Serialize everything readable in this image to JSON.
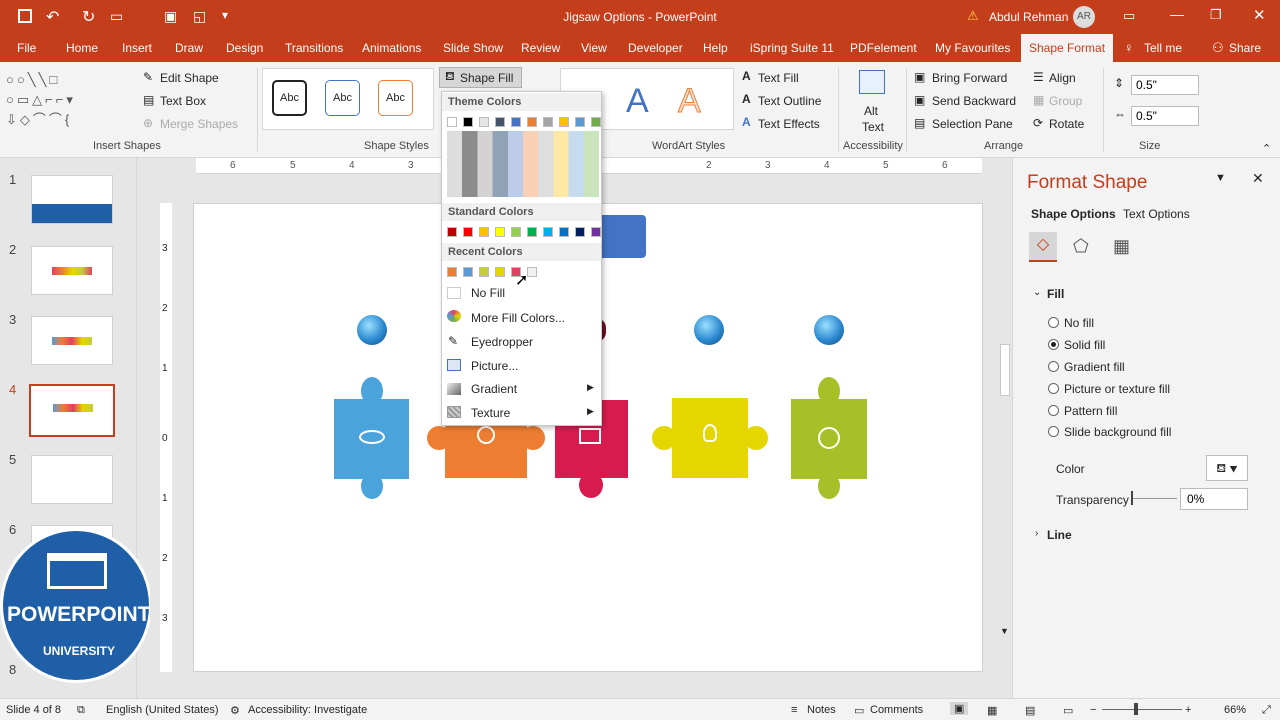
{
  "titlebar": {
    "title": "Jigsaw Options  -  PowerPoint",
    "warning": "⚠",
    "user": "Abdul Rehman",
    "initials": "AR"
  },
  "tabs": [
    "File",
    "Home",
    "Insert",
    "Draw",
    "Design",
    "Transitions",
    "Animations",
    "Slide Show",
    "Review",
    "View",
    "Developer",
    "Help",
    "iSpring Suite 11",
    "PDFelement",
    "My Favourites",
    "Shape Format",
    "Tell me",
    "Share"
  ],
  "ribbon": {
    "edit_shape": "Edit Shape",
    "text_box": "Text Box",
    "merge_shapes": "Merge Shapes",
    "insert_shapes_label": "Insert Shapes",
    "abc": "Abc",
    "shape_styles_label": "Shape Styles",
    "shape_fill": "Shape Fill",
    "text_fill": "Text Fill",
    "text_outline": "Text Outline",
    "text_effects": "Text Effects",
    "wordart_label": "WordArt Styles",
    "alt": "Alt",
    "text": "Text",
    "accessibility_label": "Accessibility",
    "bring_forward": "Bring Forward",
    "send_backward": "Send Backward",
    "selection_pane": "Selection Pane",
    "align": "Align",
    "group": "Group",
    "rotate": "Rotate",
    "arrange_label": "Arrange",
    "height": "0.5\"",
    "width": "0.5\"",
    "size_label": "Size",
    "wordart_letter": "A"
  },
  "dropdown": {
    "theme_colors": "Theme Colors",
    "standard_colors": "Standard Colors",
    "recent_colors": "Recent Colors",
    "no_fill": "No Fill",
    "more_fill": "More Fill Colors...",
    "eyedropper": "Eyedropper",
    "picture": "Picture...",
    "gradient": "Gradient",
    "texture": "Texture",
    "theme_row": [
      "#ffffff",
      "#000000",
      "#e7e6e6",
      "#44546a",
      "#4472c4",
      "#ed7d31",
      "#a5a5a5",
      "#ffc000",
      "#5b9bd5",
      "#70ad47"
    ],
    "standard_row": [
      "#c00000",
      "#ff0000",
      "#ffc000",
      "#ffff00",
      "#92d050",
      "#00b050",
      "#00b0f0",
      "#0070c0",
      "#002060",
      "#7030a0"
    ],
    "recent_row": [
      "#ed7d31",
      "#5b9bd5",
      "#c4cc3a",
      "#e5d600",
      "#e04060",
      "#f2f2f2"
    ]
  },
  "slides": {
    "numbers": [
      "1",
      "2",
      "3",
      "4",
      "5",
      "6",
      "8"
    ]
  },
  "ruler": {
    "h": [
      "6",
      "5",
      "4",
      "3",
      "2",
      "1",
      "0",
      "1",
      "2",
      "3",
      "4",
      "5",
      "6"
    ],
    "v": [
      "3",
      "2",
      "1",
      "0",
      "1",
      "2",
      "3"
    ]
  },
  "format_pane": {
    "title": "Format Shape",
    "shape_options": "Shape Options",
    "text_options": "Text Options",
    "fill": "Fill",
    "options": [
      "No fill",
      "Solid fill",
      "Gradient fill",
      "Picture or texture fill",
      "Pattern fill",
      "Slide background fill"
    ],
    "color": "Color",
    "transparency": "Transparency",
    "transparency_value": "0%",
    "line": "Line"
  },
  "logo": {
    "line1": "POWERPOINT",
    "line2": "UNIVERSITY"
  },
  "status": {
    "slide": "Slide 4 of 8",
    "language": "English (United States)",
    "accessibility": "Accessibility: Investigate",
    "notes": "Notes",
    "comments": "Comments",
    "zoom": "66%"
  }
}
